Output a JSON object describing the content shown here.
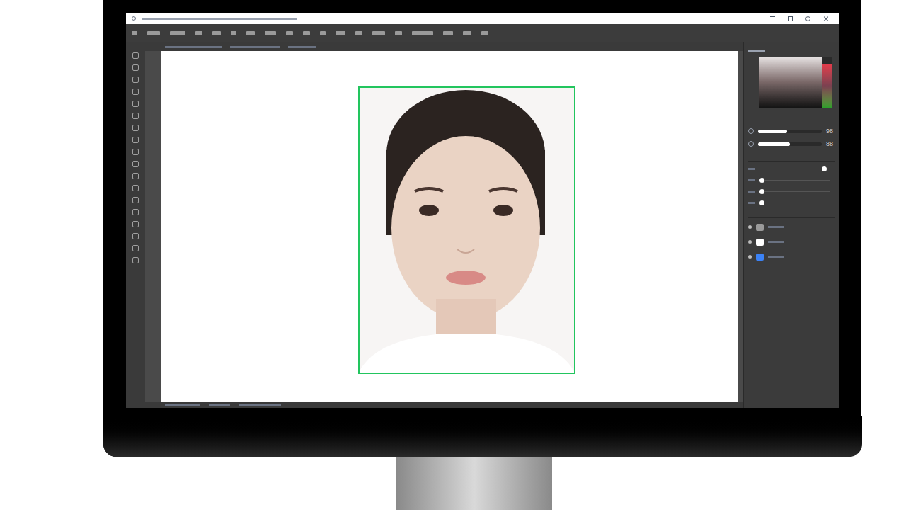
{
  "color_picker": {
    "hue_level": 0.85
  },
  "adjustments": [
    {
      "level": 0.45,
      "reading": "98"
    },
    {
      "level": 0.5,
      "reading": "88"
    }
  ],
  "brush_sliders": [
    {
      "level": 0.95
    },
    {
      "level": 0.0
    },
    {
      "level": 0.0
    },
    {
      "level": 0.0
    }
  ],
  "layers": [
    {
      "kind": "group",
      "visible": true
    },
    {
      "kind": "adjustment",
      "visible": true
    },
    {
      "kind": "image",
      "visible": true
    }
  ],
  "canvas": {
    "selection": true,
    "selection_color": "#22c55e"
  }
}
